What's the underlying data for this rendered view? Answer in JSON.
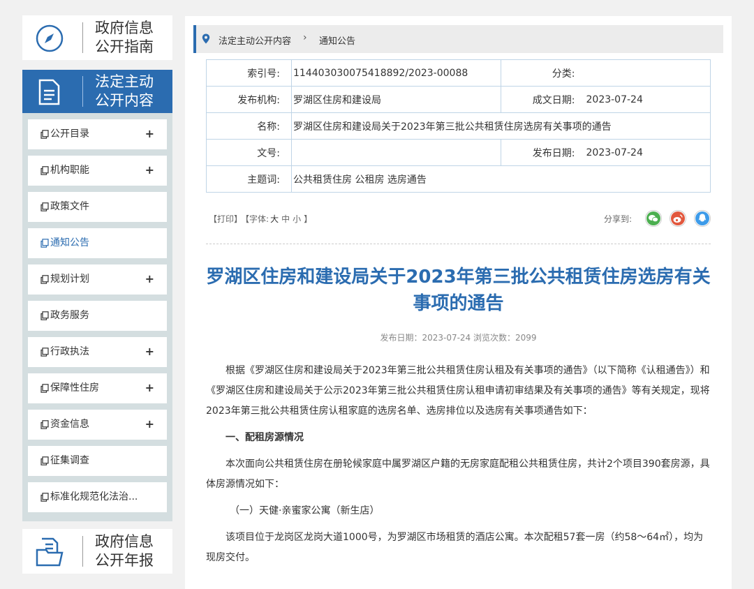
{
  "sidebar": {
    "guide_title": "政府信息公开指南",
    "statutory_title": "法定主动公开内容",
    "annual_title": "政府信息公开年报",
    "items": [
      {
        "label": "公开目录",
        "plus": "+"
      },
      {
        "label": "机构职能",
        "plus": "+"
      },
      {
        "label": "政策文件",
        "plus": ""
      },
      {
        "label": "通知公告",
        "plus": ""
      },
      {
        "label": "规划计划",
        "plus": "+"
      },
      {
        "label": "政务服务",
        "plus": ""
      },
      {
        "label": "行政执法",
        "plus": "+"
      },
      {
        "label": "保障性住房",
        "plus": "+"
      },
      {
        "label": "资金信息",
        "plus": "+"
      },
      {
        "label": "征集调查",
        "plus": ""
      },
      {
        "label": "标准化规范化法治...",
        "plus": ""
      }
    ]
  },
  "breadcrumb": {
    "level1": "法定主动公开内容",
    "separator": "›",
    "level2": "通知公告"
  },
  "meta": {
    "index_label": "索引号:",
    "index_value": "11440303007541889​2/2023-00088",
    "category_label": "分类:",
    "category_value": "",
    "publisher_label": "发布机构:",
    "publisher_value": "罗湖区住房和建设局",
    "created_label": "成文日期:",
    "created_value": "2023-07-24",
    "name_label": "名称:",
    "name_value": "罗湖区住房和建设局关于2023年第三批公共租赁住房选房有关事项的通告",
    "docno_label": "文号:",
    "docno_value": "",
    "pubdate_label": "发布日期:",
    "pubdate_value": "2023-07-24",
    "keywords_label": "主题词:",
    "keywords_value": "公共租赁住房 公租房 选房通告"
  },
  "tools": {
    "print": "【打印】",
    "font_prefix": "【字体:",
    "font_large": "大",
    "font_medium": "中",
    "font_small": "小",
    "font_suffix": "】",
    "share_label": "分享到:"
  },
  "article": {
    "title": "罗湖区住房和建设局关于2023年第三批公共租赁住房选房有关事项的通告",
    "sub": "发布日期：2023-07-24  浏览次数：2099",
    "p1": "根据《罗湖区住房和建设局关于2023年第三批公共租赁住房认租及有关事项的通告》（以下简称《认租通告》）和《罗湖区住房和建设局关于公示2023年第三批公共租赁住房认租申请初审结果及有关事项的通告》等有关规定，现将2023年第三批公共租赁住房认租家庭的选房名单、选房排位以及选房有关事项通告如下：",
    "h1": "一、配租房源情况",
    "p2": "本次面向公共租赁住房在册轮候家庭中属罗湖区户籍的无房家庭配租公共租赁住房，共计2个项目390套房源，具体房源情况如下：",
    "p3": "（一）天健·亲蜜家公寓（新生店）",
    "p4": "该项目位于龙岗区龙岗大道1000号，为罗湖区市场租赁的酒店公寓。本次配租57套一房（约58～64㎡），均为现房交付。"
  },
  "colors": {
    "brand_blue": "#2b6cb0",
    "wechat_green": "#4caf50",
    "weibo_orange": "#e2583e",
    "qq_blue": "#3d9be9"
  }
}
